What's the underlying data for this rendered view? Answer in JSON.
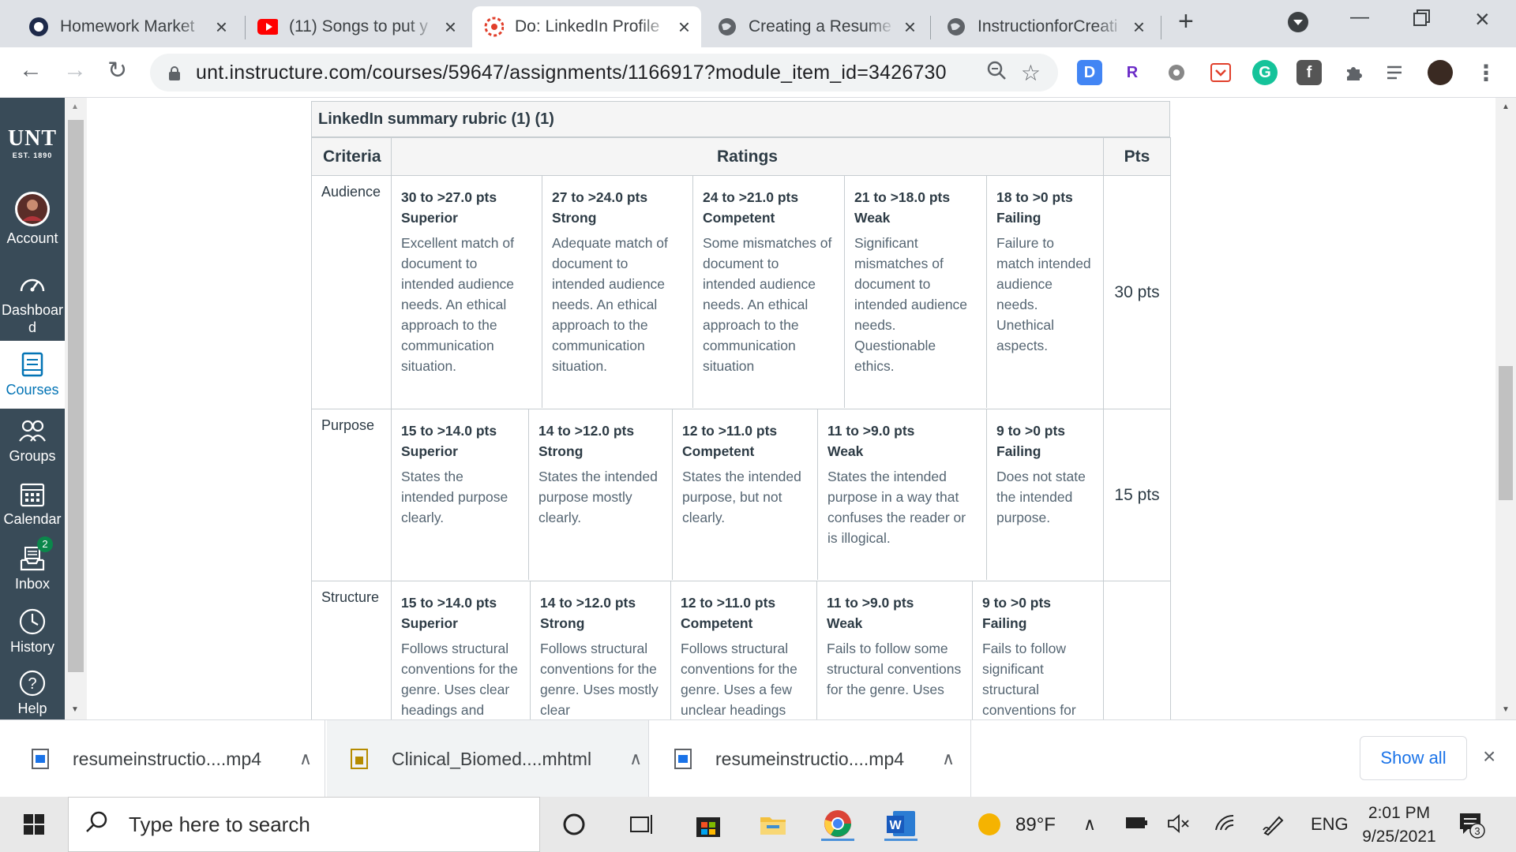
{
  "tabs": [
    {
      "title": "Homework Market",
      "active": false
    },
    {
      "title": "(11) Songs to put y",
      "active": false
    },
    {
      "title": "Do: LinkedIn Profile",
      "active": true
    },
    {
      "title": "Creating a Resume",
      "active": false
    },
    {
      "title": "InstructionforCreati",
      "active": false
    }
  ],
  "address": {
    "url": "unt.instructure.com/courses/59647/assignments/1166917?module_item_id=3426730"
  },
  "extensions": [
    "D",
    "R",
    "G"
  ],
  "nav": {
    "logo": "UNT",
    "logo_sub": "EST. 1890",
    "items": [
      {
        "label": "Account"
      },
      {
        "label": "Dashboar d"
      },
      {
        "label": "Courses"
      },
      {
        "label": "Groups"
      },
      {
        "label": "Calendar"
      },
      {
        "label": "Inbox",
        "badge": "2"
      },
      {
        "label": "History"
      },
      {
        "label": "Help"
      }
    ]
  },
  "rubric": {
    "title": "LinkedIn summary rubric (1) (1)",
    "headers": {
      "criteria": "Criteria",
      "ratings": "Ratings",
      "pts": "Pts"
    },
    "rows": [
      {
        "criterion": "Audience",
        "points": "30 pts",
        "ratings": [
          {
            "pts": "30 to >27.0 pts",
            "name": "Superior",
            "desc": "Excellent match of document to intended audience needs. An ethical approach to the communication situation."
          },
          {
            "pts": "27 to >24.0 pts",
            "name": "Strong",
            "desc": "Adequate match of document to intended audience needs. An ethical approach to the communication situation."
          },
          {
            "pts": "24 to >21.0 pts",
            "name": "Competent",
            "desc": "Some mismatches of document to intended audience needs. An ethical approach to the communication situation"
          },
          {
            "pts": "21 to >18.0 pts",
            "name": "Weak",
            "desc": "Significant mismatches of document to intended audience needs. Questionable ethics."
          },
          {
            "pts": "18 to >0 pts",
            "name": "Failing",
            "desc": "Failure to match intended audience needs. Unethical aspects."
          }
        ]
      },
      {
        "criterion": "Purpose",
        "points": "15 pts",
        "ratings": [
          {
            "pts": "15 to >14.0 pts",
            "name": "Superior",
            "desc": "States the intended purpose clearly."
          },
          {
            "pts": "14 to >12.0 pts",
            "name": "Strong",
            "desc": "States the intended purpose mostly clearly."
          },
          {
            "pts": "12 to >11.0 pts",
            "name": "Competent",
            "desc": "States the intended purpose, but not clearly."
          },
          {
            "pts": "11 to >9.0 pts",
            "name": "Weak",
            "desc": "States the intended purpose in a way that confuses the reader or is illogical."
          },
          {
            "pts": "9 to >0 pts",
            "name": "Failing",
            "desc": "Does not state the intended purpose."
          }
        ]
      },
      {
        "criterion": "Structure",
        "points": "",
        "ratings": [
          {
            "pts": "15 to >14.0 pts",
            "name": "Superior",
            "desc": "Follows structural conventions for the genre. Uses clear headings and"
          },
          {
            "pts": "14 to >12.0 pts",
            "name": "Strong",
            "desc": "Follows structural conventions for the genre. Uses mostly clear"
          },
          {
            "pts": "12 to >11.0 pts",
            "name": "Competent",
            "desc": "Follows structural conventions for the genre. Uses a few unclear headings"
          },
          {
            "pts": "11 to >9.0 pts",
            "name": "Weak",
            "desc": "Fails to follow some structural conventions for the genre. Uses"
          },
          {
            "pts": "9 to >0 pts",
            "name": "Failing",
            "desc": "Fails to follow significant structural conventions for"
          }
        ]
      }
    ]
  },
  "downloads": {
    "items": [
      "resumeinstructio....mp4",
      "Clinical_Biomed....mhtml",
      "resumeinstructio....mp4"
    ],
    "show_all": "Show all"
  },
  "taskbar": {
    "search_placeholder": "Type here to search",
    "weather": "89°F",
    "lang": "ENG",
    "time": "2:01 PM",
    "date": "9/25/2021",
    "notifications": "3"
  },
  "colors": {
    "nav_bg": "#394b58",
    "nav_active": "#0374b5",
    "link_blue": "#1a73e8"
  }
}
